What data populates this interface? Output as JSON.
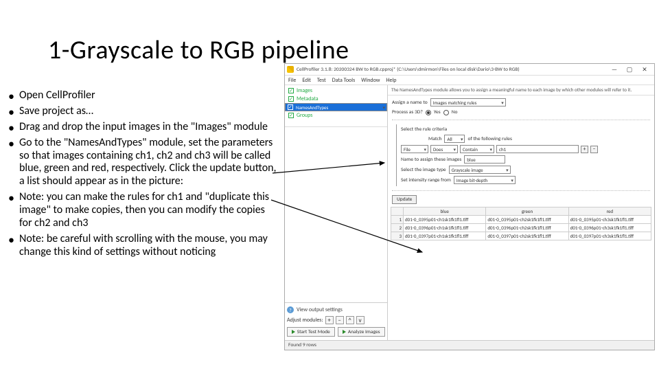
{
  "slide": {
    "title": "1-Grayscale to RGB pipeline"
  },
  "bullets": [
    "Open CellProfiler",
    "Save project as…",
    "Drag and drop the input images in the \"Images\" module",
    "Go to the \"NamesAndTypes\" module, set the parameters so that images containing ch1, ch2 and ch3 will be called blue, green and red, respectively. Click the update button, a list should appear as in the picture:",
    "Note: you can make the rules for ch1 and \"duplicate this image\" to make copies, then you can modify the copies for ch2 and ch3",
    "Note: be careful with scrolling with the mouse, you may change this kind of settings without noticing"
  ],
  "window": {
    "title": "CellProfiler 3.1.8: 20200324 BW to RGB.cpproj* (C:\\Users\\dmirmon\\Files on local disk\\Dario\\3-BW to RGB)",
    "controls": {
      "min": "—",
      "max": "▢",
      "close": "✕"
    },
    "menus": [
      "File",
      "Edit",
      "Test",
      "Data Tools",
      "Window",
      "Help"
    ]
  },
  "pipeline": {
    "items": [
      {
        "label": "Images",
        "selected": false
      },
      {
        "label": "Metadata",
        "selected": false
      },
      {
        "label": "NamesAndTypes",
        "selected": true
      },
      {
        "label": "Groups",
        "selected": false
      }
    ]
  },
  "module": {
    "description": "The NamesAndTypes module allows you to assign a meaningful name to each image by which other modules will refer to it.",
    "assign_label": "Assign a name to",
    "assign_value": "Images matching rules",
    "process3d_label": "Process as 3D?",
    "process3d_yes": "Yes",
    "process3d_no": "No",
    "rule_header_prefix": "Select the rule criteria",
    "match_label": "Match",
    "match_value": "All",
    "match_suffix": "of the following rules",
    "rule": {
      "subject": "File",
      "verb": "Does",
      "op": "Contain",
      "value": "ch1"
    },
    "name_label": "Name to assign these images",
    "name_value": "blue",
    "imgtype_label": "Select the image type",
    "imgtype_value": "Grayscale image",
    "intensity_label": "Set intensity range from",
    "intensity_value": "Image bit-depth",
    "update_btn": "Update"
  },
  "table": {
    "headers": [
      "",
      "blue",
      "green",
      "red"
    ],
    "rows": [
      [
        "1",
        "d01-0_0395p01-ch1sk1fk1fl1.tiff",
        "d01-0_0395p01-ch2sk1fk1fl1.tiff",
        "d01-0_0395p01-ch3sk1fk1fl1.tiff"
      ],
      [
        "2",
        "d01-0_0396p01-ch1sk1fk1fl1.tiff",
        "d01-0_0396p01-ch2sk1fk1fl1.tiff",
        "d01-0_0396p01-ch3sk1fk1fl1.tiff"
      ],
      [
        "3",
        "d01-0_0397p01-ch1sk1fk1fl1.tiff",
        "d01-0_0397p01-ch2sk1fk1fl1.tiff",
        "d01-0_0397p01-ch3sk1fk1fl1.tiff"
      ]
    ]
  },
  "left_bottom": {
    "output_link": "View output settings",
    "adjust_label": "Adjust modules:",
    "start_btn": "Start Test Mode",
    "analyze_btn": "Analyze Images"
  },
  "status": {
    "text": "Found 9 rows"
  }
}
